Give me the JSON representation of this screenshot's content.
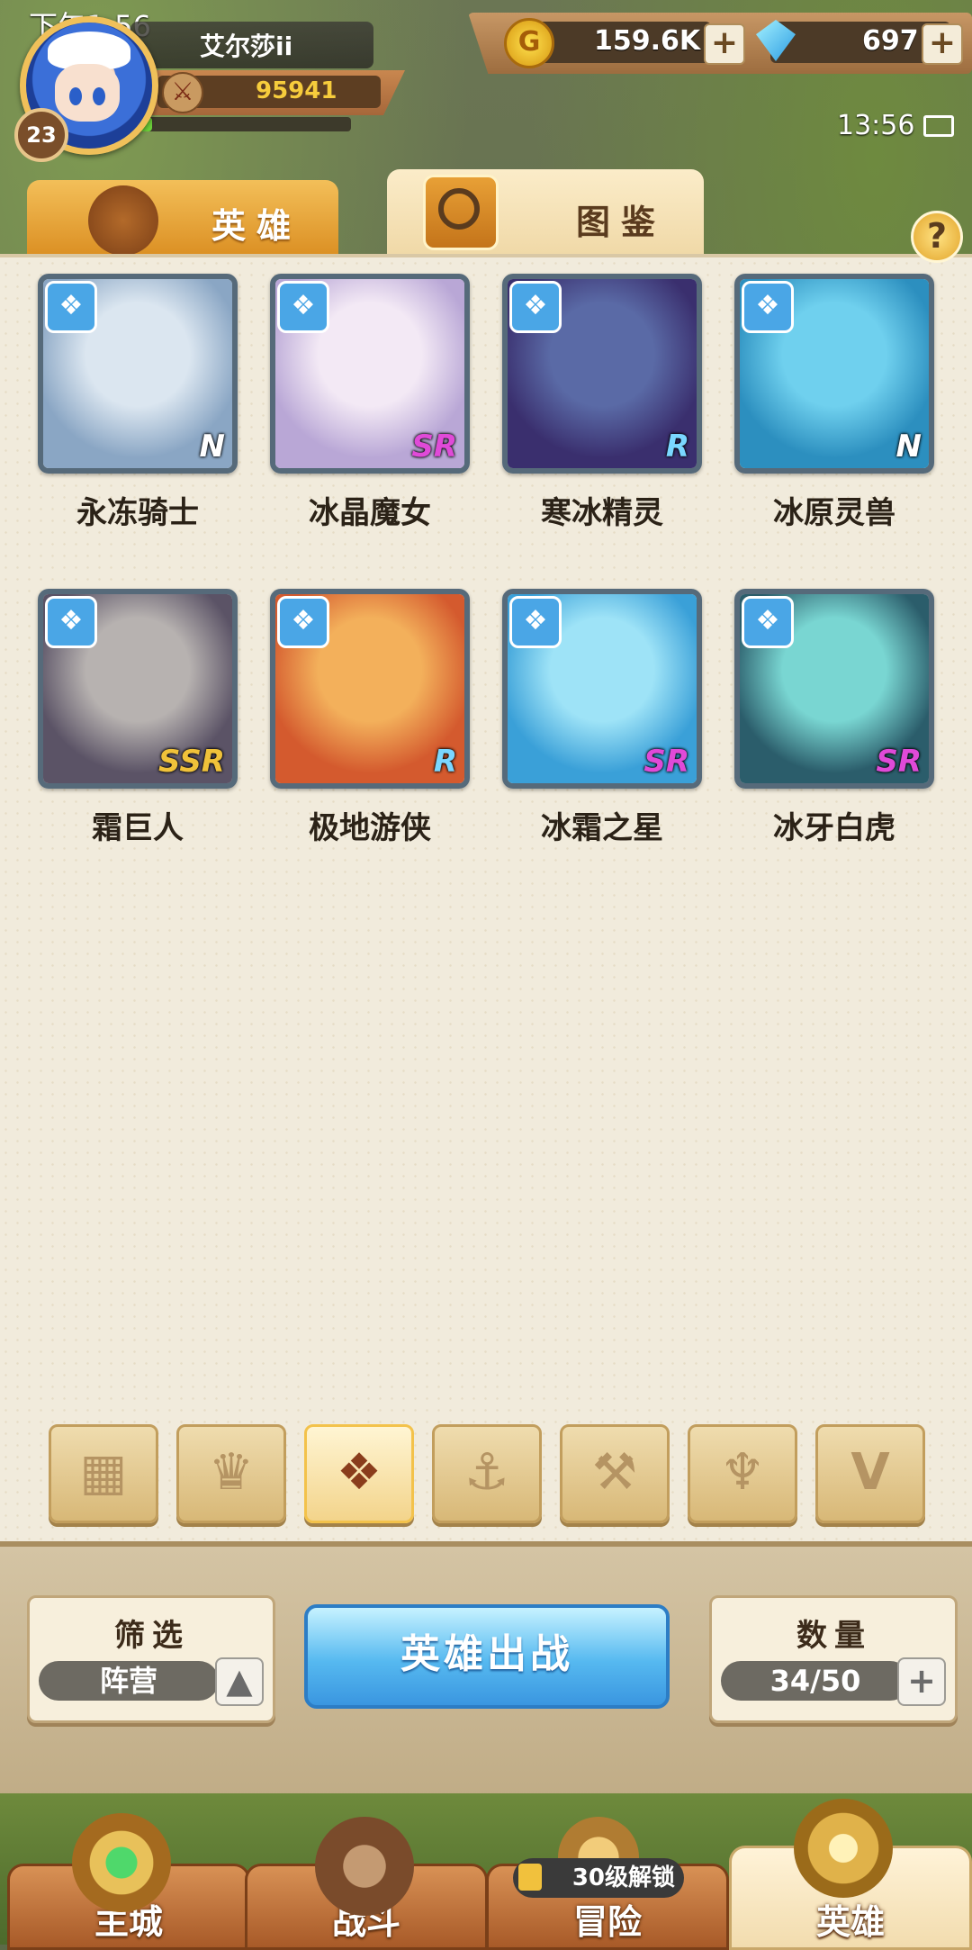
{
  "status": {
    "time": "下午1:56",
    "clock": "13:56"
  },
  "player": {
    "name": "艾尔莎ii",
    "level": "23",
    "power": "95941",
    "exp_fraction": 0.08
  },
  "currency": {
    "gold": "159.6K",
    "gems": "697",
    "plus": "+"
  },
  "tabs": [
    {
      "label": "英雄"
    },
    {
      "label": "图鉴"
    }
  ],
  "help": "?",
  "heroes": [
    {
      "name": "永冻骑士",
      "rarity": "N",
      "rarity_color": "#ffffff",
      "art": [
        "#dbe6f0",
        "#8aa6c4"
      ]
    },
    {
      "name": "冰晶魔女",
      "rarity": "SR",
      "rarity_color": "#e04ad8",
      "art": [
        "#f3e9f5",
        "#b9a7d6"
      ]
    },
    {
      "name": "寒冰精灵",
      "rarity": "R",
      "rarity_color": "#7ad7ff",
      "art": [
        "#5a6aa6",
        "#3a2f6e"
      ]
    },
    {
      "name": "冰原灵兽",
      "rarity": "N",
      "rarity_color": "#ffffff",
      "art": [
        "#6fd0ee",
        "#2c8fbf"
      ]
    },
    {
      "name": "霜巨人",
      "rarity": "SSR",
      "rarity_color": "#f0c23a",
      "art": [
        "#b7b2b0",
        "#5b5366"
      ]
    },
    {
      "name": "极地游侠",
      "rarity": "R",
      "rarity_color": "#7ad7ff",
      "art": [
        "#f3b05b",
        "#d45a2e"
      ]
    },
    {
      "name": "冰霜之星",
      "rarity": "SR",
      "rarity_color": "#e04ad8",
      "art": [
        "#9ee3f7",
        "#3aa0d8"
      ]
    },
    {
      "name": "冰牙白虎",
      "rarity": "SR",
      "rarity_color": "#e04ad8",
      "art": [
        "#79d6d2",
        "#2b5d6b"
      ]
    }
  ],
  "filters": [
    {
      "icon": "▦",
      "name": "all-filter"
    },
    {
      "icon": "♛",
      "name": "faction-1-filter"
    },
    {
      "icon": "❖",
      "name": "ice-faction-filter"
    },
    {
      "icon": "⚓",
      "name": "sea-faction-filter"
    },
    {
      "icon": "⚒",
      "name": "beast-faction-filter"
    },
    {
      "icon": "♆",
      "name": "dark-faction-filter"
    },
    {
      "icon": "V",
      "name": "demon-faction-filter"
    }
  ],
  "active_filter_index": 2,
  "controls": {
    "filter_title": "筛选",
    "filter_value": "阵营",
    "deploy": "英雄出战",
    "count_title": "数量",
    "count_value": "34/50"
  },
  "nav": [
    {
      "label": "主城"
    },
    {
      "label": "战斗"
    },
    {
      "label": "冒险",
      "lock": "30级解锁"
    },
    {
      "label": "英雄"
    }
  ]
}
